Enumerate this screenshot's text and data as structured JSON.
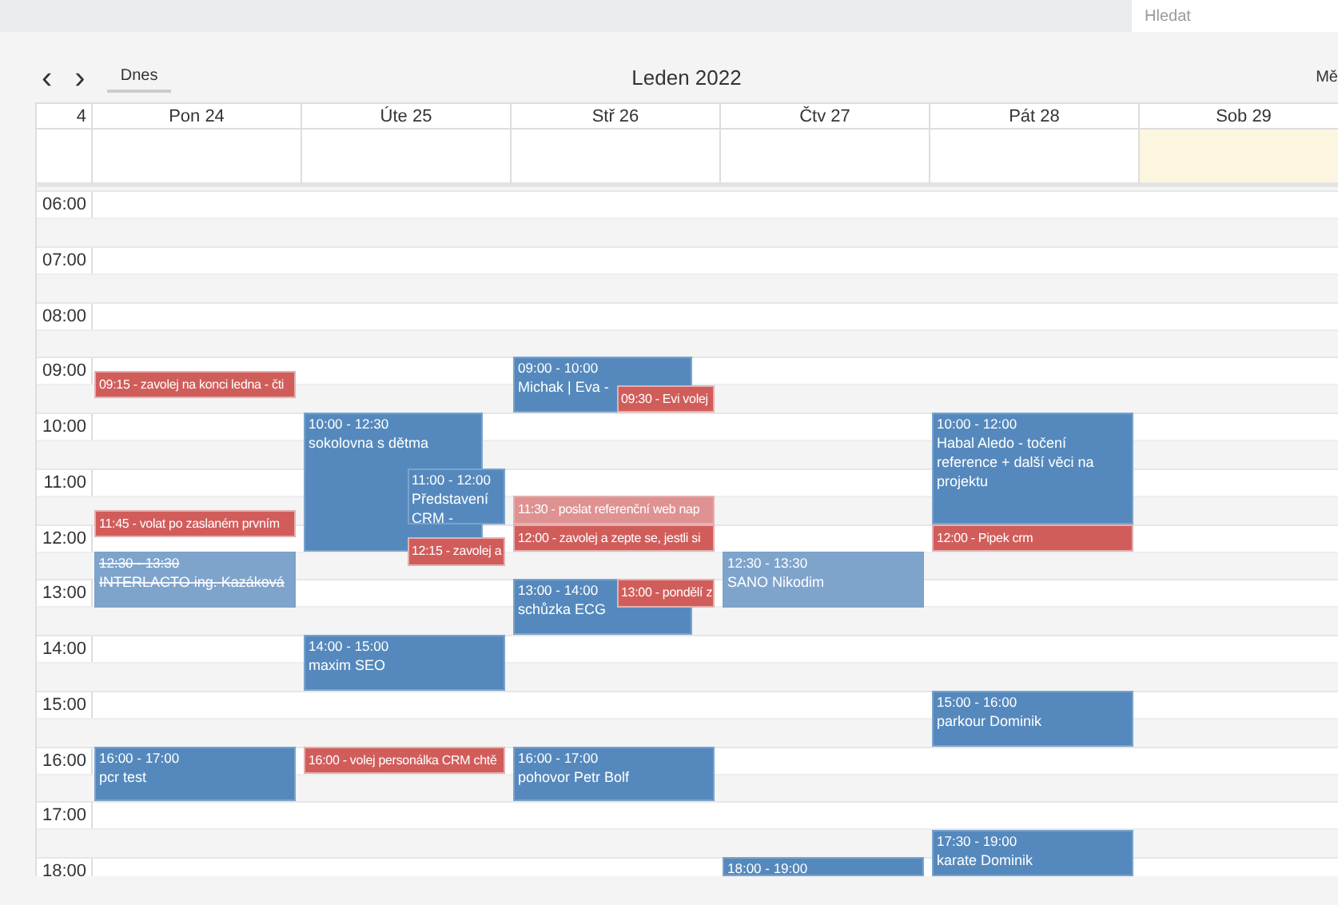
{
  "search": {
    "placeholder": "Hledat"
  },
  "toolbar": {
    "prev": "‹",
    "next": "›",
    "today": "Dnes",
    "title": "Leden 2022",
    "view": "Mě"
  },
  "week": "4",
  "hours": [
    "06:00",
    "07:00",
    "08:00",
    "09:00",
    "10:00",
    "11:00",
    "12:00",
    "13:00",
    "14:00",
    "15:00",
    "16:00",
    "17:00",
    "18:00"
  ],
  "days": [
    {
      "label": "Pon 24",
      "today": false,
      "events": [
        {
          "kind": "task",
          "text": "09:15 - zavolej na konci ledna - čti",
          "done": false
        },
        {
          "kind": "task",
          "text": "11:45 - volat po zaslaném prvním",
          "done": false
        },
        {
          "kind": "event",
          "time": "12:30 - 13:30",
          "title": "INTERLACTO ing. Kazáková",
          "done": true,
          "crossed_out": true
        },
        {
          "kind": "event",
          "time": "16:00 - 17:00",
          "title": "pcr test",
          "done": false
        }
      ]
    },
    {
      "label": "Úte 25",
      "today": false,
      "events": [
        {
          "kind": "event",
          "time": "10:00 - 12:30",
          "title": "sokolovna s dětma",
          "done": false
        },
        {
          "kind": "event",
          "time": "11:00 - 12:00",
          "title": "Představení CRM -",
          "done": false
        },
        {
          "kind": "task",
          "text": "12:15 - zavolej a",
          "done": false
        },
        {
          "kind": "event",
          "time": "14:00 - 15:00",
          "title": "maxim SEO",
          "done": false
        },
        {
          "kind": "task",
          "text": "16:00 - volej personálka CRM chtě",
          "done": false
        }
      ]
    },
    {
      "label": "Stř 26",
      "today": false,
      "events": [
        {
          "kind": "event",
          "time": "09:00 - 10:00",
          "title": "Michak | Eva -",
          "done": false
        },
        {
          "kind": "task",
          "text": "09:30 - Evi volej",
          "done": false
        },
        {
          "kind": "task",
          "text": "11:30 - poslat referenční web nap",
          "done": true
        },
        {
          "kind": "task",
          "text": "12:00 - zavolej a zepte se, jestli si",
          "done": false
        },
        {
          "kind": "event",
          "time": "13:00 - 14:00",
          "title": "schůzka ECG",
          "done": false
        },
        {
          "kind": "task",
          "text": "13:00 - pondělí z",
          "done": false
        },
        {
          "kind": "event",
          "time": "16:00 - 17:00",
          "title": "pohovor Petr Bolf",
          "done": false
        }
      ]
    },
    {
      "label": "Čtv 27",
      "today": false,
      "events": [
        {
          "kind": "event",
          "time": "12:30 - 13:30",
          "title": "SANO Nikodim",
          "done": true
        },
        {
          "kind": "event",
          "time": "18:00 - 19:00",
          "done": false
        }
      ]
    },
    {
      "label": "Pát 28",
      "today": false,
      "events": [
        {
          "kind": "event",
          "time": "10:00 - 12:00",
          "title": "Habal Aledo - točení reference + další věci na projektu",
          "done": false
        },
        {
          "kind": "task",
          "text": "12:00 - Pipek crm",
          "done": false
        },
        {
          "kind": "event",
          "time": "15:00 - 16:00",
          "title": "parkour Dominik",
          "done": false
        },
        {
          "kind": "event",
          "time": "17:30 - 19:00",
          "title": "karate Dominik",
          "done": false
        }
      ]
    },
    {
      "label": "Sob 29",
      "today": true
    }
  ]
}
